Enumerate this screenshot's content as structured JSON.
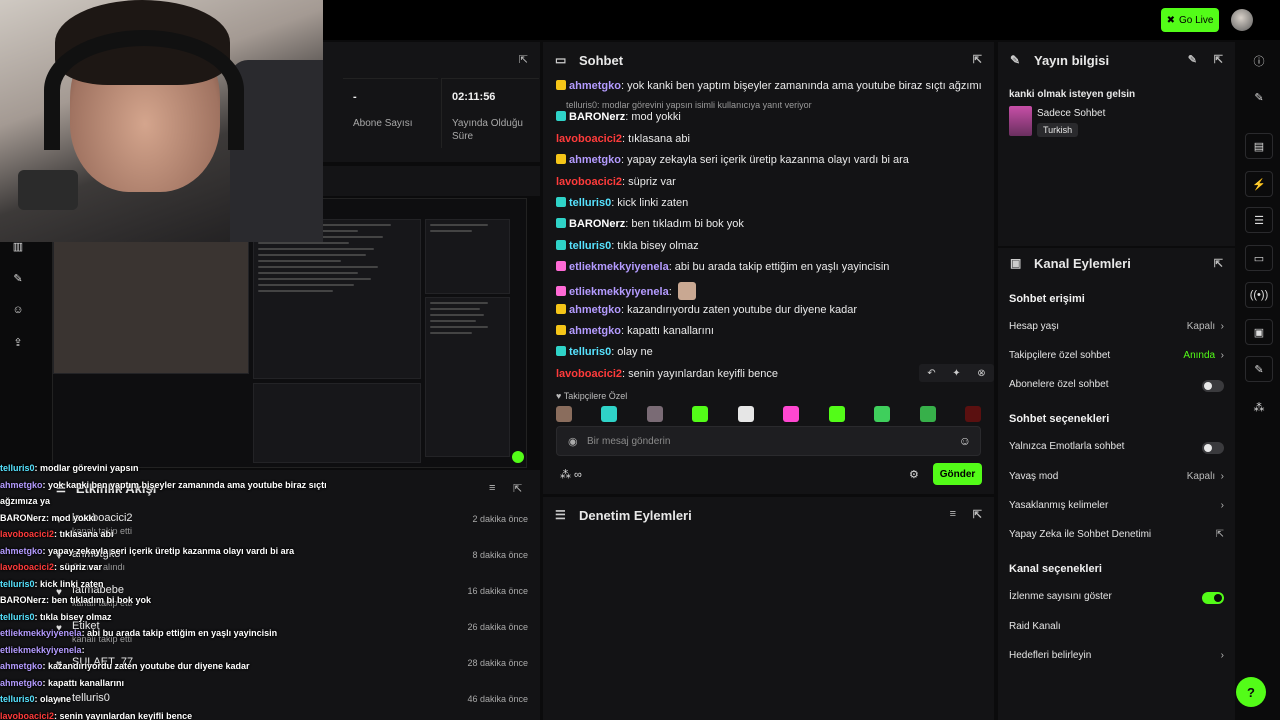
{
  "topbar": {
    "go_live_label": "Go Live"
  },
  "stats": {
    "items": [
      {
        "value": "-",
        "label": "Abone Sayısı"
      },
      {
        "value": "02:11:56",
        "label": "Yayında Olduğu Süre"
      }
    ]
  },
  "activity": {
    "title": "Etkinlik Akışı",
    "rows": [
      {
        "name": "lavoboacici2",
        "sub": "kanalı takip etti",
        "time": "2 dakika önce"
      },
      {
        "name": "ahmetgko",
        "sub": "Cansın alındı",
        "time": "8 dakika önce"
      },
      {
        "name": "fatmabebe",
        "sub": "kanalı takip etti",
        "time": "16 dakika önce"
      },
      {
        "name": "Etiket",
        "sub": "kanalı takip etti",
        "time": "26 dakika önce"
      },
      {
        "name": "SULAET_77",
        "sub": "",
        "time": "28 dakika önce"
      },
      {
        "name": "telluris0",
        "sub": "",
        "time": "46 dakika önce"
      }
    ]
  },
  "overlay_chat": [
    {
      "user": "telluris0",
      "text": ": modlar görevini yapsın",
      "color": "#57e3ff"
    },
    {
      "user": "ahmetgko",
      "text": ": yok kanki ben yaptım bişeyler zamanında ama youtube biraz sıçtı",
      "color": "#b49bff"
    },
    {
      "user": "",
      "text": "ağzımıza ya",
      "color": "#ffffff"
    },
    {
      "user": "BARONerz",
      "text": ": mod yokki",
      "color": "#ffffff"
    },
    {
      "user": "lavoboacici2",
      "text": ": tıklasana abi",
      "color": "#ff3b3b"
    },
    {
      "user": "ahmetgko",
      "text": ": yapay zekayla seri içerik üretip kazanma olayı vardı bi ara",
      "color": "#b49bff"
    },
    {
      "user": "lavoboacici2",
      "text": ": süpriz var",
      "color": "#ff3b3b"
    },
    {
      "user": "telluris0",
      "text": ": kick linki zaten",
      "color": "#57e3ff"
    },
    {
      "user": "BARONerz",
      "text": ": ben tıkladım bi bok yok",
      "color": "#ffffff"
    },
    {
      "user": "telluris0",
      "text": ": tıkla bisey olmaz",
      "color": "#57e3ff"
    },
    {
      "user": "etliekmekkyiyenela",
      "text": ": abi bu arada takip ettiğim en yaşlı yayincisin",
      "color": "#b49bff"
    },
    {
      "user": "etliekmekkyiyenela",
      "text": ":",
      "color": "#b49bff"
    },
    {
      "user": "ahmetgko",
      "text": ": kazandırıyordu zaten youtube dur diyene kadar",
      "color": "#b49bff"
    },
    {
      "user": "ahmetgko",
      "text": ": kapattı kanallarını",
      "color": "#b49bff"
    },
    {
      "user": "telluris0",
      "text": ": olay ne",
      "color": "#57e3ff"
    },
    {
      "user": "lavoboacici2",
      "text": ": senin yayınlardan keyifli bence",
      "color": "#ff3b3b"
    }
  ],
  "chat": {
    "title": "Sohbet",
    "reply_hint": "telluris0: modlar görevini yapsın isimli kullanıcıya yanıt veriyor",
    "messages": [
      {
        "user": "ahmetgko",
        "text": ": yok kanki ben yaptım bişeyler zamanında ama youtube biraz sıçtı ağzımıza ya",
        "color": "#b49bff",
        "badge": "#f5c518"
      },
      {
        "user": "BARONerz",
        "text": ": mod yokki",
        "color": "#ffffff",
        "badge": "#2fd3c8"
      },
      {
        "user": "lavoboacici2",
        "text": ": tıklasana abi",
        "color": "#ff3b3b",
        "badge": ""
      },
      {
        "user": "ahmetgko",
        "text": ": yapay zekayla seri içerik üretip kazanma olayı vardı bi ara",
        "color": "#b49bff",
        "badge": "#f5c518"
      },
      {
        "user": "lavoboacici2",
        "text": ": süpriz var",
        "color": "#ff3b3b",
        "badge": ""
      },
      {
        "user": "telluris0",
        "text": ": kick linki zaten",
        "color": "#57e3ff",
        "badge": "#2fd3c8"
      },
      {
        "user": "BARONerz",
        "text": ": ben tıkladım bi bok yok",
        "color": "#ffffff",
        "badge": "#2fd3c8"
      },
      {
        "user": "telluris0",
        "text": ": tıkla bisey olmaz",
        "color": "#57e3ff",
        "badge": "#2fd3c8"
      },
      {
        "user": "etliekmekkyiyenela",
        "text": ": abi bu arada takip ettiğim en yaşlı yayincisin",
        "color": "#b49bff",
        "badge": "#ff6ad5"
      },
      {
        "user": "etliekmekkyiyenela",
        "text": ":",
        "color": "#b49bff",
        "badge": "#ff6ad5"
      },
      {
        "user": "ahmetgko",
        "text": ": kazandırıyordu zaten youtube dur diyene kadar",
        "color": "#b49bff",
        "badge": "#f5c518"
      },
      {
        "user": "ahmetgko",
        "text": ": kapattı kanallarını",
        "color": "#b49bff",
        "badge": "#f5c518"
      },
      {
        "user": "telluris0",
        "text": ": olay ne",
        "color": "#57e3ff",
        "badge": "#2fd3c8"
      },
      {
        "user": "lavoboacici2",
        "text": ": senin yayınlardan keyifli bence",
        "color": "#ff3b3b",
        "badge": ""
      }
    ],
    "emote_section_label": "Takipçilere Özel",
    "input_placeholder": "Bir mesaj gönderin",
    "send_label": "Gönder"
  },
  "moderation": {
    "title": "Denetim Eylemleri"
  },
  "stream_info": {
    "title": "Yayın bilgisi",
    "stream_title": "kanki olmak isteyen gelsin",
    "category": "Sadece Sohbet",
    "language_tag": "Turkish"
  },
  "channel_actions": {
    "title": "Kanal Eylemleri",
    "chat_access_title": "Sohbet erişimi",
    "account_age_label": "Hesap yaşı",
    "account_age_value": "Kapalı",
    "followers_only_label": "Takipçilere özel sohbet",
    "followers_only_value": "Anında",
    "subscribers_only_label": "Abonelere özel sohbet",
    "chat_options_title": "Sohbet seçenekleri",
    "emote_only_label": "Yalnızca Emotlarla sohbet",
    "slow_mode_label": "Yavaş mod",
    "slow_mode_value": "Kapalı",
    "banned_words_label": "Yasaklanmış kelimeler",
    "ai_moderation_label": "Yapay Zeka ile Sohbet Denetimi",
    "channel_options_title": "Kanal seçenekleri",
    "show_viewer_count_label": "İzlenme sayısını göster",
    "raid_label": "Raid Kanalı",
    "goals_label": "Hedefleri belirleyin"
  },
  "colors": {
    "accent": "#53fc18",
    "panel": "#131315",
    "background": "#0b0b0c"
  }
}
